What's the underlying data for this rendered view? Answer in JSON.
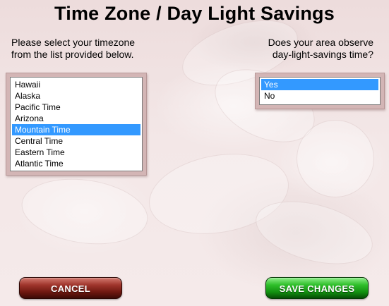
{
  "title": "Time Zone / Day Light Savings",
  "timezone": {
    "prompt_line1": "Please select your timezone",
    "prompt_line2": "from the list provided below.",
    "options": [
      "Hawaii",
      "Alaska",
      "Pacific Time",
      "Arizona",
      "Mountain Time",
      "Central Time",
      "Eastern Time",
      "Atlantic Time"
    ],
    "selected": "Mountain Time"
  },
  "dst": {
    "prompt_line1": "Does your area observe",
    "prompt_line2": "day-light-savings time?",
    "options": [
      "Yes",
      "No"
    ],
    "selected": "Yes"
  },
  "buttons": {
    "cancel_label": "CANCEL",
    "save_label": "SAVE CHANGES"
  },
  "colors": {
    "selection": "#3399ff",
    "cancel": "#8b2a20",
    "save": "#1aa316"
  }
}
